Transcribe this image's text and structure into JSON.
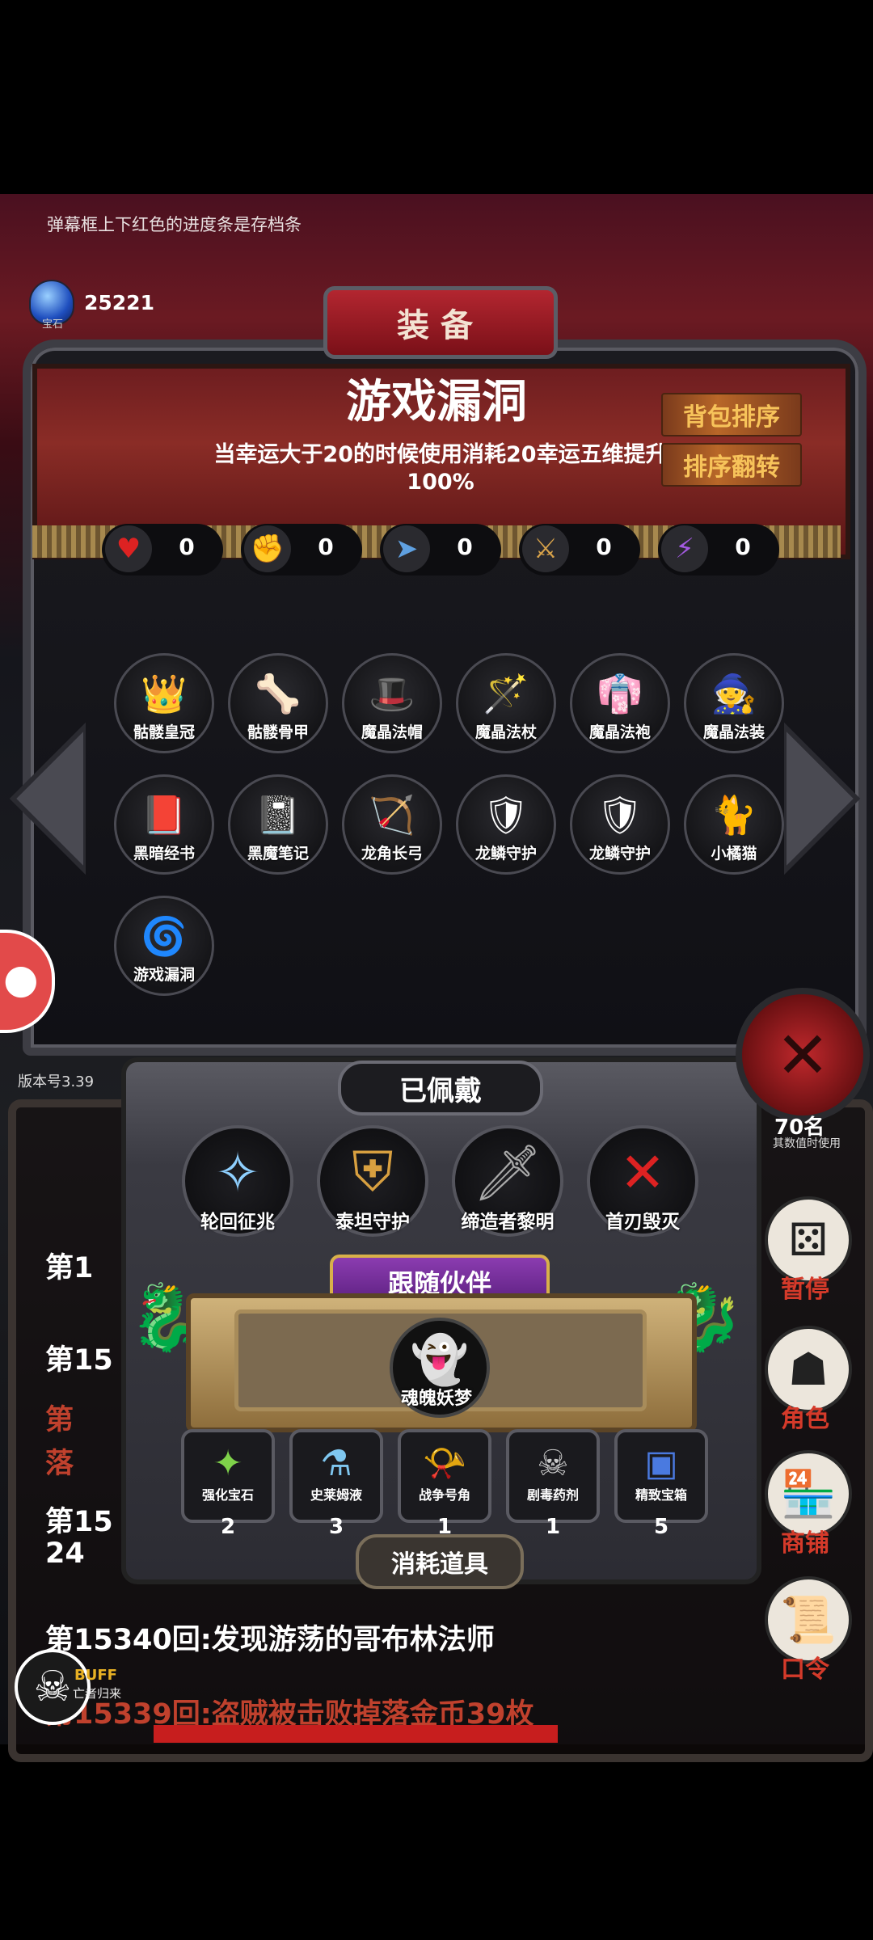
{
  "tip": "弹幕框上下红色的进度条是存档条",
  "gems": {
    "label": "宝石",
    "count": "25221"
  },
  "panel": {
    "title": "装备",
    "item_name": "游戏漏洞",
    "item_desc": "当幸运大于20的时候使用消耗20幸运五维提升100%",
    "sort_button": "背包排序",
    "reverse_button": "排序翻转",
    "stats": [
      {
        "icon": "heart-icon",
        "value": "0"
      },
      {
        "icon": "strength-icon",
        "value": "0"
      },
      {
        "icon": "agility-icon",
        "value": "0"
      },
      {
        "icon": "sword-icon",
        "value": "0"
      },
      {
        "icon": "lightning-icon",
        "value": "0"
      }
    ],
    "inventory": [
      "骷髅皇冠",
      "骷髅骨甲",
      "魔晶法帽",
      "魔晶法杖",
      "魔晶法袍",
      "魔晶法装",
      "黑暗经书",
      "黑魔笔记",
      "龙角长弓",
      "龙鳞守护",
      "龙鳞守护",
      "小橘猫",
      "游戏漏洞"
    ]
  },
  "version": "版本号3.39",
  "equipped": {
    "header": "已佩戴",
    "items": [
      "轮回征兆",
      "泰坦守护",
      "缔造者黎明",
      "首刃毁灭"
    ]
  },
  "companion": {
    "header": "跟随伙伴",
    "name": "魂魄妖梦"
  },
  "consumables": {
    "header": "消耗道具",
    "items": [
      {
        "name": "强化宝石",
        "count": "2"
      },
      {
        "name": "史莱姆液",
        "count": "3"
      },
      {
        "name": "战争号角",
        "count": "1"
      },
      {
        "name": "剧毒药剂",
        "count": "1"
      },
      {
        "name": "精致宝箱",
        "count": "5"
      }
    ]
  },
  "right_menu": {
    "gold_value": "70名",
    "gold_sub": "其数值时使用",
    "pause": "暂停",
    "character": "角色",
    "shop": "商铺",
    "command": "口令"
  },
  "log": {
    "l1": "第1",
    "l2": "第15",
    "l3a": "第",
    "l3b": "落",
    "l4a": "第15",
    "l4b": "24",
    "l5": "第15340回:发现游荡的哥布林法师",
    "l6": "第15339回:盗贼被击败掉落金币39枚"
  },
  "buff": {
    "label": "BUFF",
    "sub": "亡者归来"
  },
  "colors": {
    "banner": "#8a2c26",
    "accent_red": "#c71e1e",
    "gold_text": "#f7c35a"
  }
}
